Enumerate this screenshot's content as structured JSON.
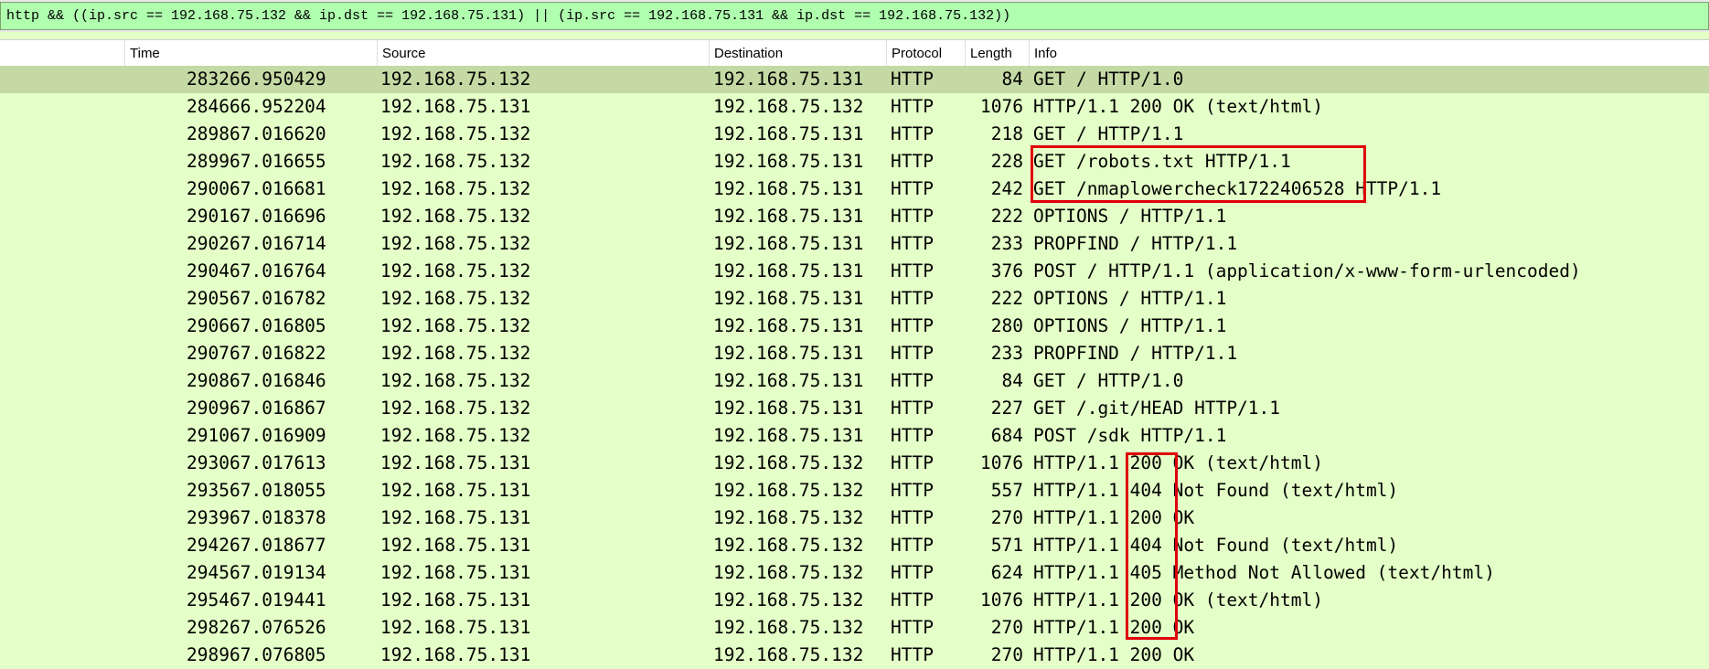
{
  "filter": {
    "value": "http && ((ip.src == 192.168.75.132 && ip.dst == 192.168.75.131) || (ip.src == 192.168.75.131 && ip.dst == 192.168.75.132))"
  },
  "columns": {
    "no": "",
    "time": "Time",
    "source": "Source",
    "destination": "Destination",
    "protocol": "Protocol",
    "length": "Length",
    "info": "Info"
  },
  "packets": [
    {
      "no": "2832",
      "time": "66.950429",
      "src": "192.168.75.132",
      "dst": "192.168.75.131",
      "proto": "HTTP",
      "len": "84",
      "info": "GET / HTTP/1.0",
      "selected": true
    },
    {
      "no": "2846",
      "time": "66.952204",
      "src": "192.168.75.131",
      "dst": "192.168.75.132",
      "proto": "HTTP",
      "len": "1076",
      "info": "HTTP/1.1 200 OK  (text/html)"
    },
    {
      "no": "2898",
      "time": "67.016620",
      "src": "192.168.75.132",
      "dst": "192.168.75.131",
      "proto": "HTTP",
      "len": "218",
      "info": "GET / HTTP/1.1"
    },
    {
      "no": "2899",
      "time": "67.016655",
      "src": "192.168.75.132",
      "dst": "192.168.75.131",
      "proto": "HTTP",
      "len": "228",
      "info": "GET /robots.txt HTTP/1.1"
    },
    {
      "no": "2900",
      "time": "67.016681",
      "src": "192.168.75.132",
      "dst": "192.168.75.131",
      "proto": "HTTP",
      "len": "242",
      "info": "GET /nmaplowercheck1722406528 HTTP/1.1"
    },
    {
      "no": "2901",
      "time": "67.016696",
      "src": "192.168.75.132",
      "dst": "192.168.75.131",
      "proto": "HTTP",
      "len": "222",
      "info": "OPTIONS / HTTP/1.1"
    },
    {
      "no": "2902",
      "time": "67.016714",
      "src": "192.168.75.132",
      "dst": "192.168.75.131",
      "proto": "HTTP",
      "len": "233",
      "info": "PROPFIND / HTTP/1.1"
    },
    {
      "no": "2904",
      "time": "67.016764",
      "src": "192.168.75.132",
      "dst": "192.168.75.131",
      "proto": "HTTP",
      "len": "376",
      "info": "POST / HTTP/1.1  (application/x-www-form-urlencoded)"
    },
    {
      "no": "2905",
      "time": "67.016782",
      "src": "192.168.75.132",
      "dst": "192.168.75.131",
      "proto": "HTTP",
      "len": "222",
      "info": "OPTIONS / HTTP/1.1"
    },
    {
      "no": "2906",
      "time": "67.016805",
      "src": "192.168.75.132",
      "dst": "192.168.75.131",
      "proto": "HTTP",
      "len": "280",
      "info": "OPTIONS / HTTP/1.1"
    },
    {
      "no": "2907",
      "time": "67.016822",
      "src": "192.168.75.132",
      "dst": "192.168.75.131",
      "proto": "HTTP",
      "len": "233",
      "info": "PROPFIND / HTTP/1.1"
    },
    {
      "no": "2908",
      "time": "67.016846",
      "src": "192.168.75.132",
      "dst": "192.168.75.131",
      "proto": "HTTP",
      "len": "84",
      "info": "GET / HTTP/1.0"
    },
    {
      "no": "2909",
      "time": "67.016867",
      "src": "192.168.75.132",
      "dst": "192.168.75.131",
      "proto": "HTTP",
      "len": "227",
      "info": "GET /.git/HEAD HTTP/1.1"
    },
    {
      "no": "2910",
      "time": "67.016909",
      "src": "192.168.75.132",
      "dst": "192.168.75.131",
      "proto": "HTTP",
      "len": "684",
      "info": "POST /sdk HTTP/1.1"
    },
    {
      "no": "2930",
      "time": "67.017613",
      "src": "192.168.75.131",
      "dst": "192.168.75.132",
      "proto": "HTTP",
      "len": "1076",
      "info": "HTTP/1.1 200 OK  (text/html)"
    },
    {
      "no": "2935",
      "time": "67.018055",
      "src": "192.168.75.131",
      "dst": "192.168.75.132",
      "proto": "HTTP",
      "len": "557",
      "info": "HTTP/1.1 404 Not Found  (text/html)"
    },
    {
      "no": "2939",
      "time": "67.018378",
      "src": "192.168.75.131",
      "dst": "192.168.75.132",
      "proto": "HTTP",
      "len": "270",
      "info": "HTTP/1.1 200 OK"
    },
    {
      "no": "2942",
      "time": "67.018677",
      "src": "192.168.75.131",
      "dst": "192.168.75.132",
      "proto": "HTTP",
      "len": "571",
      "info": "HTTP/1.1 404 Not Found  (text/html)"
    },
    {
      "no": "2945",
      "time": "67.019134",
      "src": "192.168.75.131",
      "dst": "192.168.75.132",
      "proto": "HTTP",
      "len": "624",
      "info": "HTTP/1.1 405 Method Not Allowed  (text/html)"
    },
    {
      "no": "2954",
      "time": "67.019441",
      "src": "192.168.75.131",
      "dst": "192.168.75.132",
      "proto": "HTTP",
      "len": "1076",
      "info": "HTTP/1.1 200 OK  (text/html)"
    },
    {
      "no": "2982",
      "time": "67.076526",
      "src": "192.168.75.131",
      "dst": "192.168.75.132",
      "proto": "HTTP",
      "len": "270",
      "info": "HTTP/1.1 200 OK"
    }
  ],
  "partial_row": {
    "no": "2989",
    "time": "67.076805",
    "src": "192.168.75.131",
    "dst": "192.168.75.132",
    "proto": "HTTP",
    "len": "270",
    "info": "HTTP/1.1 200 OK"
  },
  "colors": {
    "row_bg": "#e4ffc7",
    "selected_bg": "#c4d9a3",
    "filter_bg": "#afffaf",
    "annotation_red": "#e0000a"
  }
}
